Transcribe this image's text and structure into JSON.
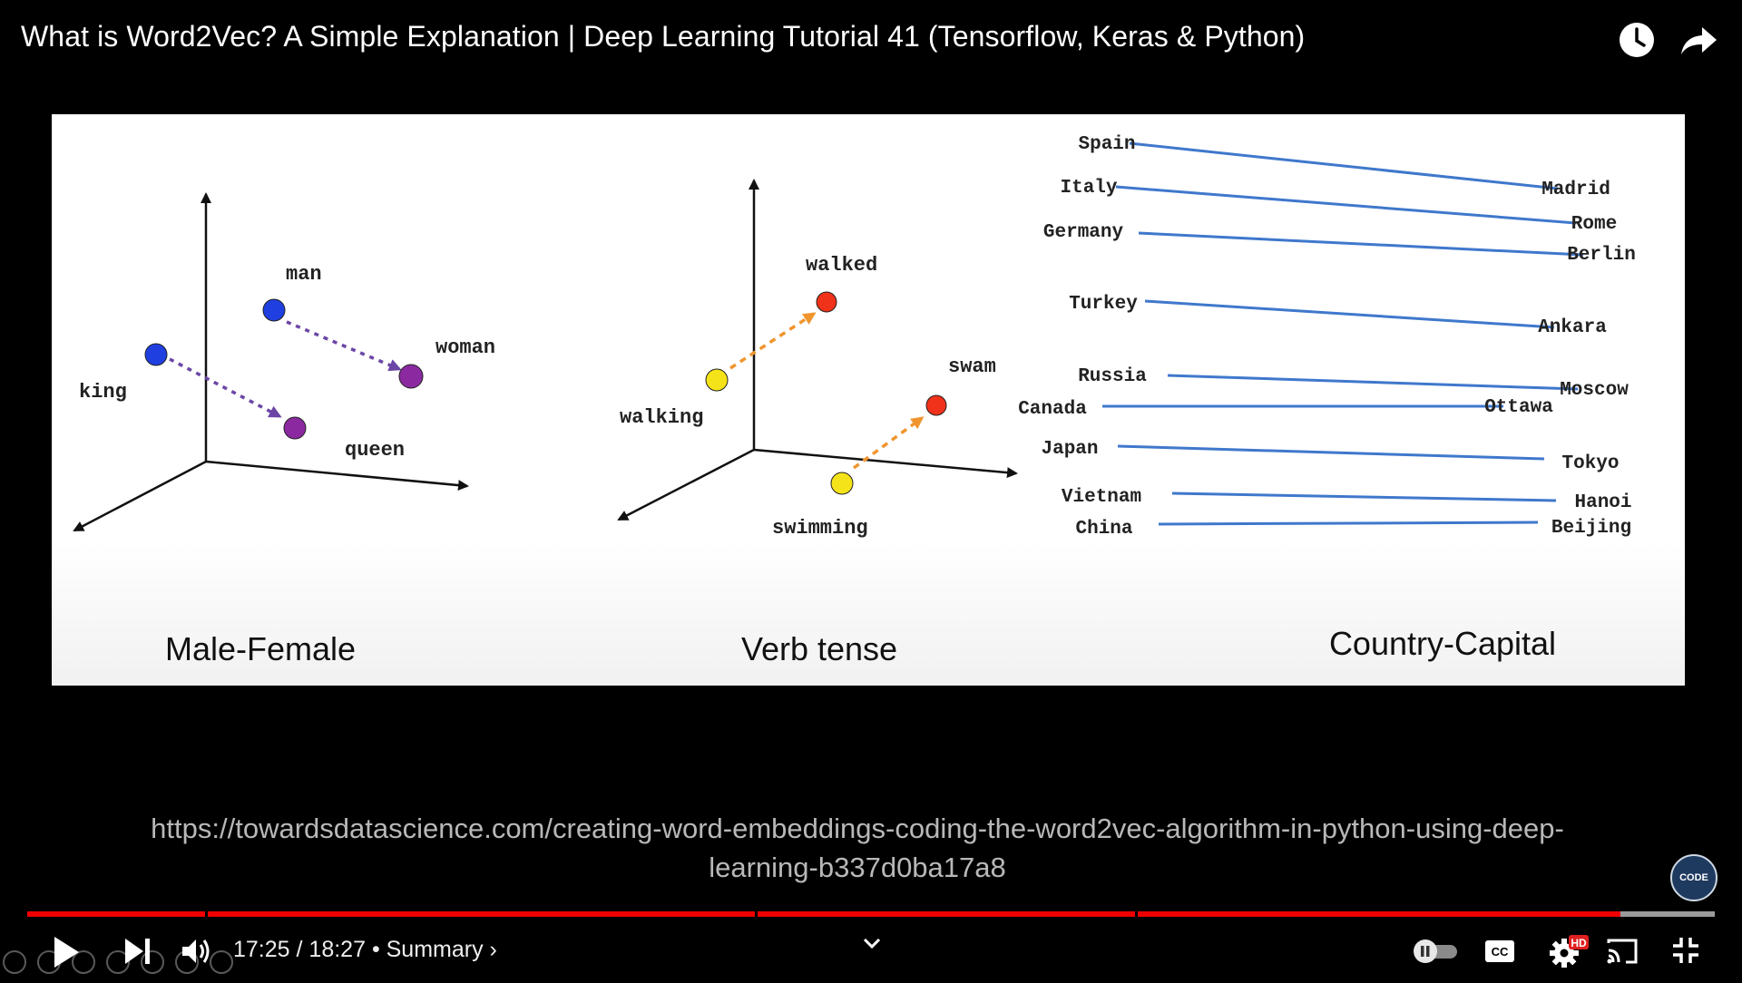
{
  "video": {
    "title": "What is Word2Vec? A Simple Explanation | Deep Learning Tutorial 41 (Tensorflow, Keras & Python)"
  },
  "top_actions": [
    {
      "name": "watch-later-icon"
    },
    {
      "name": "share-icon"
    }
  ],
  "slide": {
    "panels": [
      {
        "caption": "Male-Female",
        "words": {
          "man": "man",
          "woman": "woman",
          "king": "king",
          "queen": "queen"
        }
      },
      {
        "caption": "Verb tense",
        "words": {
          "walked": "walked",
          "walking": "walking",
          "swam": "swam",
          "swimming": "swimming"
        }
      },
      {
        "caption": "Country-Capital",
        "pairs": [
          {
            "country": "Spain",
            "capital": "Madrid"
          },
          {
            "country": "Italy",
            "capital": "Rome"
          },
          {
            "country": "Germany",
            "capital": "Berlin"
          },
          {
            "country": "Turkey",
            "capital": "Ankara"
          },
          {
            "country": "Russia",
            "capital": "Moscow"
          },
          {
            "country": "Canada",
            "capital": "Ottawa"
          },
          {
            "country": "Japan",
            "capital": "Tokyo"
          },
          {
            "country": "Vietnam",
            "capital": "Hanoi"
          },
          {
            "country": "China",
            "capital": "Beijing"
          }
        ]
      }
    ],
    "colors": {
      "blue_dot": "#1f3fe0",
      "purple_dot": "#8b2aa0",
      "yellow_dot": "#f5e31a",
      "red_dot": "#f0321a",
      "purple_arrow": "#6b46a6",
      "orange_arrow": "#f0952e",
      "capital_line": "#3f78cc"
    }
  },
  "source_url": {
    "line1": "https://towardsdatascience.com/creating-word-embeddings-coding-the-word2vec-algorithm-in-python-using-deep-",
    "line2": "learning-b337d0ba17a8"
  },
  "channel_watermark": {
    "text": "CODE"
  },
  "player": {
    "progress_fraction": 0.944,
    "time_current": "17:25",
    "time_total": "18:27",
    "time_separator": "/",
    "chapter_label": "• Summary ›",
    "accent_color": "#ee0000",
    "quality_badge": "HD",
    "controls": [
      "play-icon",
      "next-icon",
      "volume-icon",
      "chevron-down-icon",
      "autoplay-toggle",
      "captions-icon",
      "settings-icon",
      "cast-icon",
      "exit-fullscreen-icon"
    ],
    "captions_label": "CC"
  }
}
